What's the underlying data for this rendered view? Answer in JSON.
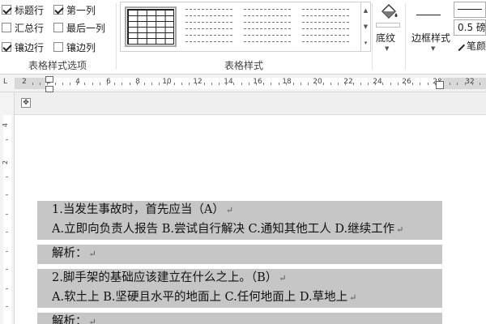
{
  "ribbon": {
    "style_options": {
      "group_label": "表格样式选项",
      "options": [
        {
          "label": "标题行",
          "checked": true
        },
        {
          "label": "第一列",
          "checked": true
        },
        {
          "label": "汇总行",
          "checked": false
        },
        {
          "label": "最后一列",
          "checked": false
        },
        {
          "label": "镶边行",
          "checked": true
        },
        {
          "label": "镶边列",
          "checked": false
        }
      ]
    },
    "table_styles": {
      "group_label": "表格样式"
    },
    "shading": {
      "label": "底纹",
      "icon": "paint-bucket-icon"
    },
    "borders": {
      "border_styles_label": "边框样式",
      "pen_weight": "0.5 磅",
      "pen_color_label": "笔颜"
    }
  },
  "ruler": {
    "tab_selector": "L",
    "numbers": [
      "2",
      "2",
      "4",
      "6",
      "8",
      "10",
      "12",
      "14",
      "16",
      "18",
      "20",
      "22",
      "24",
      "26",
      "28",
      "30",
      "32"
    ],
    "vertical_numbers": [
      "4",
      "2"
    ]
  },
  "document": {
    "move_handle": "✥",
    "lines": [
      "1.当发生事故时，首先应当（A）",
      "A.立即向负责人报告  B.尝试自行解决  C.通知其他工人  D.继续工作",
      "解析：",
      "2.脚手架的基础应该建立在什么之上。（B）",
      "A.软土上  B.坚硬且水平的地面上  C.任何地面上  D.草地上",
      "解析："
    ],
    "paragraph_mark": "↵"
  }
}
